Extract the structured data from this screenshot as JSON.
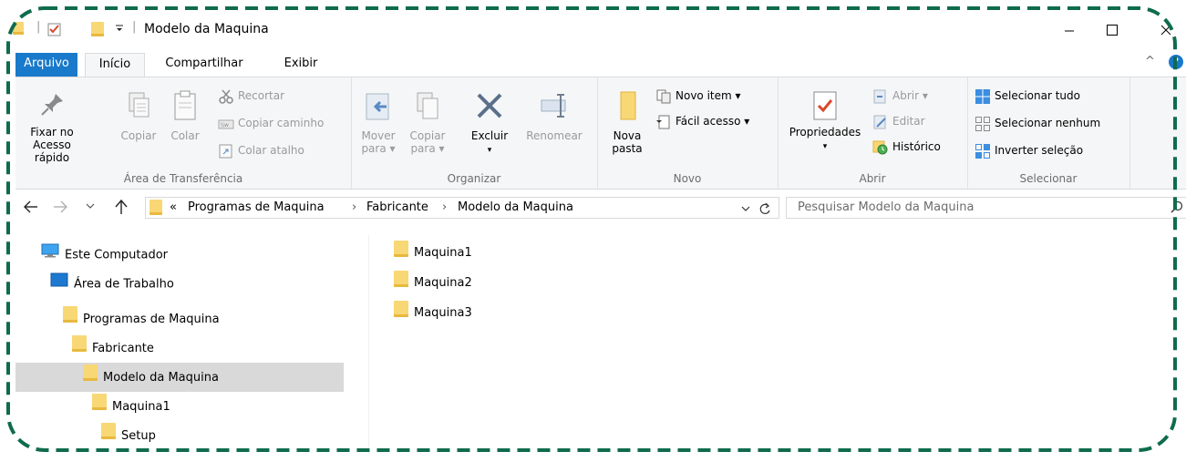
{
  "window": {
    "title": "Modelo da Maquina",
    "quick_access_separator": "|",
    "minimize": "—",
    "maximize": "☐",
    "close": "✕"
  },
  "tabs": [
    "Arquivo",
    "Início",
    "Compartilhar",
    "Exibir"
  ],
  "ribbon": {
    "groups": {
      "clipboard": "Área de Transferência",
      "organize": "Organizar",
      "new": "Novo",
      "open": "Abrir",
      "select": "Selecionar"
    },
    "pin": "Fixar no\nAcesso rápido",
    "copy": "Copiar",
    "paste": "Colar",
    "cut": "Recortar",
    "copy_path": "Copiar caminho",
    "paste_shortcut": "Colar atalho",
    "move_to": "Mover\npara ▾",
    "copy_to": "Copiar\npara ▾",
    "delete": "Excluir",
    "delete_arrow": "▾",
    "rename": "Renomear",
    "new_folder": "Nova\npasta",
    "new_item": "Novo item ▾",
    "easy_access": "Fácil acesso ▾",
    "properties": "Propriedades",
    "properties_arrow": "▾",
    "open_btn": "Abrir ▾",
    "edit": "Editar",
    "history": "Histórico",
    "select_all": "Selecionar tudo",
    "select_none": "Selecionar nenhum",
    "invert_selection": "Inverter seleção",
    "collapse": "^",
    "help": "?"
  },
  "nav": {
    "breadcrumb": [
      "Programas de Maquina",
      "Fabricante",
      "Modelo da Maquina"
    ],
    "overflow": "«",
    "sep": "›",
    "search_placeholder": "Pesquisar Modelo da Maquina"
  },
  "tree": [
    {
      "label": "Este Computador",
      "icon": "computer"
    },
    {
      "label": "Área de Trabalho",
      "icon": "desktop"
    },
    {
      "label": "Programas de Maquina",
      "icon": "folder"
    },
    {
      "label": "Fabricante",
      "icon": "folder"
    },
    {
      "label": "Modelo da Maquina",
      "icon": "folder",
      "selected": true
    },
    {
      "label": "Maquina1",
      "icon": "folder"
    },
    {
      "label": "Setup",
      "icon": "folder"
    }
  ],
  "files": [
    "Maquina1",
    "Maquina2",
    "Maquina3"
  ],
  "colors": {
    "frame_dash": "#0f6b4e",
    "accent": "#1979ca",
    "ribbon_bg": "#f5f6f7",
    "selected_bg": "#d9d9d9",
    "folder": "#f8d775"
  }
}
